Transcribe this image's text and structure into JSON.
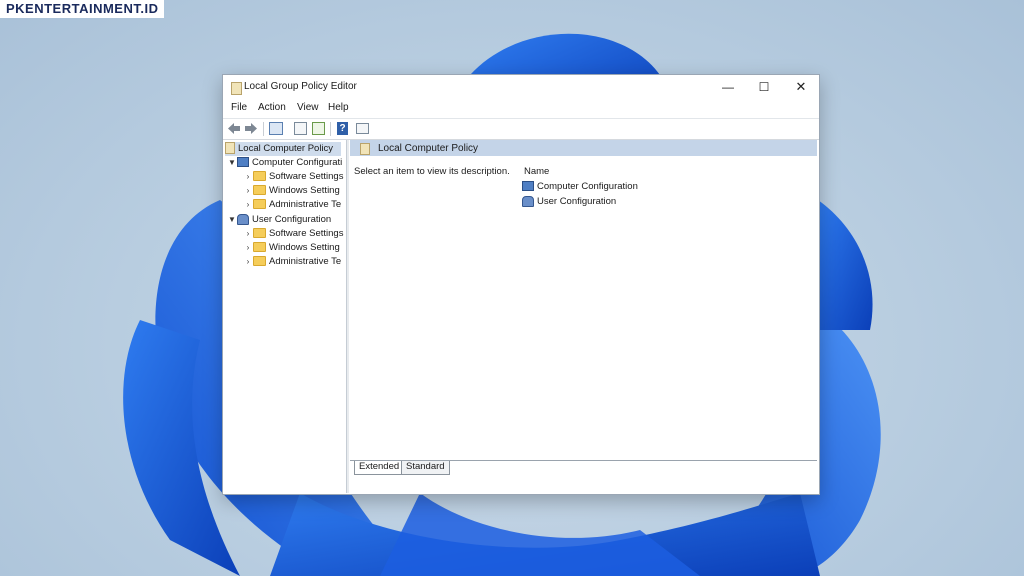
{
  "watermark": "PKENTERTAINMENT.ID",
  "window": {
    "title": "Local Group Policy Editor",
    "controls": {
      "minimize": "—",
      "maximize": "☐",
      "close": "✕"
    }
  },
  "menu": [
    "File",
    "Action",
    "View",
    "Help"
  ],
  "toolbar": {
    "icons": [
      "back-arrow-icon",
      "forward-arrow-icon",
      "show-hide-tree-icon",
      "properties-icon",
      "export-list-icon",
      "help-icon",
      "filter-icon"
    ],
    "help_glyph": "?"
  },
  "tree": {
    "root": "Local Computer Policy",
    "computer": {
      "label": "Computer Configurati",
      "children": [
        "Software Settings",
        "Windows Setting",
        "Administrative Te"
      ]
    },
    "user": {
      "label": "User Configuration",
      "children": [
        "Software Settings",
        "Windows Setting",
        "Administrative Te"
      ]
    }
  },
  "right": {
    "header": "Local Computer Policy",
    "description": "Select an item to view its description.",
    "column_name": "Name",
    "items": [
      "Computer Configuration",
      "User Configuration"
    ]
  },
  "tabs": [
    "Extended",
    "Standard"
  ],
  "colors": {
    "accent": "#0067c0",
    "header_bar": "#c4d4e8",
    "selection": "#cfdcec",
    "folder": "#f5cd5a"
  }
}
